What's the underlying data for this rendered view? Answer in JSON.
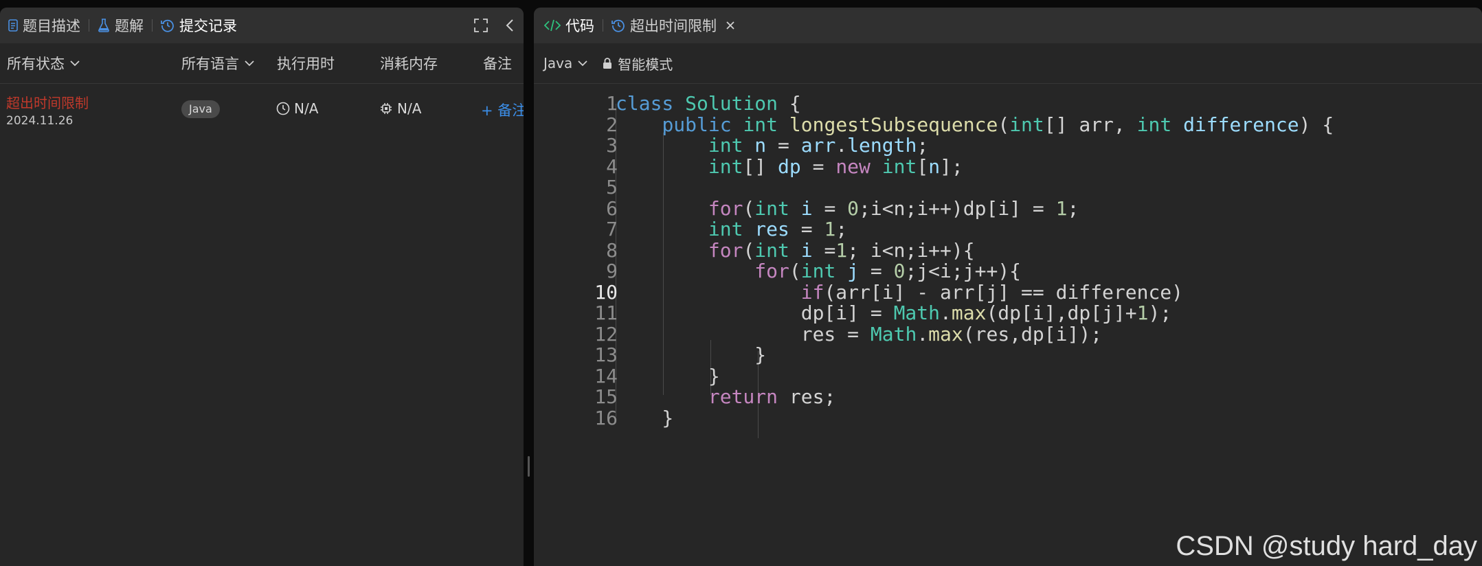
{
  "left_panel": {
    "tabs": [
      {
        "label": "题目描述",
        "icon": "document-icon"
      },
      {
        "label": "题解",
        "icon": "flask-icon"
      },
      {
        "label": "提交记录",
        "icon": "history-icon",
        "active": true
      }
    ],
    "filters": {
      "status": "所有状态",
      "language": "所有语言",
      "runtime": "执行用时",
      "memory": "消耗内存",
      "notes": "备注"
    },
    "submissions": [
      {
        "status": "超出时间限制",
        "date": "2024.11.26",
        "language": "Java",
        "runtime": "N/A",
        "memory": "N/A",
        "note_action": "+ 备注"
      }
    ]
  },
  "right_panel": {
    "tabs": [
      {
        "label": "代码",
        "icon": "code-icon",
        "active": true
      },
      {
        "label": "超出时间限制",
        "icon": "history-icon",
        "closable": true
      }
    ],
    "toolbar": {
      "language": "Java",
      "mode": "智能模式"
    },
    "editor": {
      "current_line": 10,
      "lines": [
        "class Solution {",
        "    public int longestSubsequence(int[] arr, int difference) {",
        "        int n = arr.length;",
        "        int[] dp = new int[n];",
        "",
        "        for(int i = 0;i<n;i++)dp[i] = 1;",
        "        int res = 1;",
        "        for(int i =1; i<n;i++){",
        "            for(int j = 0;j<i;j++){",
        "                if(arr[i] - arr[j] == difference)",
        "                dp[i] = Math.max(dp[i],dp[j]+1);",
        "                res = Math.max(res,dp[i]);",
        "            }",
        "        }",
        "        return res;",
        "    }"
      ]
    }
  },
  "watermark": "CSDN @study hard_day",
  "colors": {
    "status_error": "#c0392b",
    "accent_blue": "#3b8ee8",
    "code_green": "#2ec27e",
    "panel_bg": "#262626",
    "tabbar_bg": "#303030"
  }
}
